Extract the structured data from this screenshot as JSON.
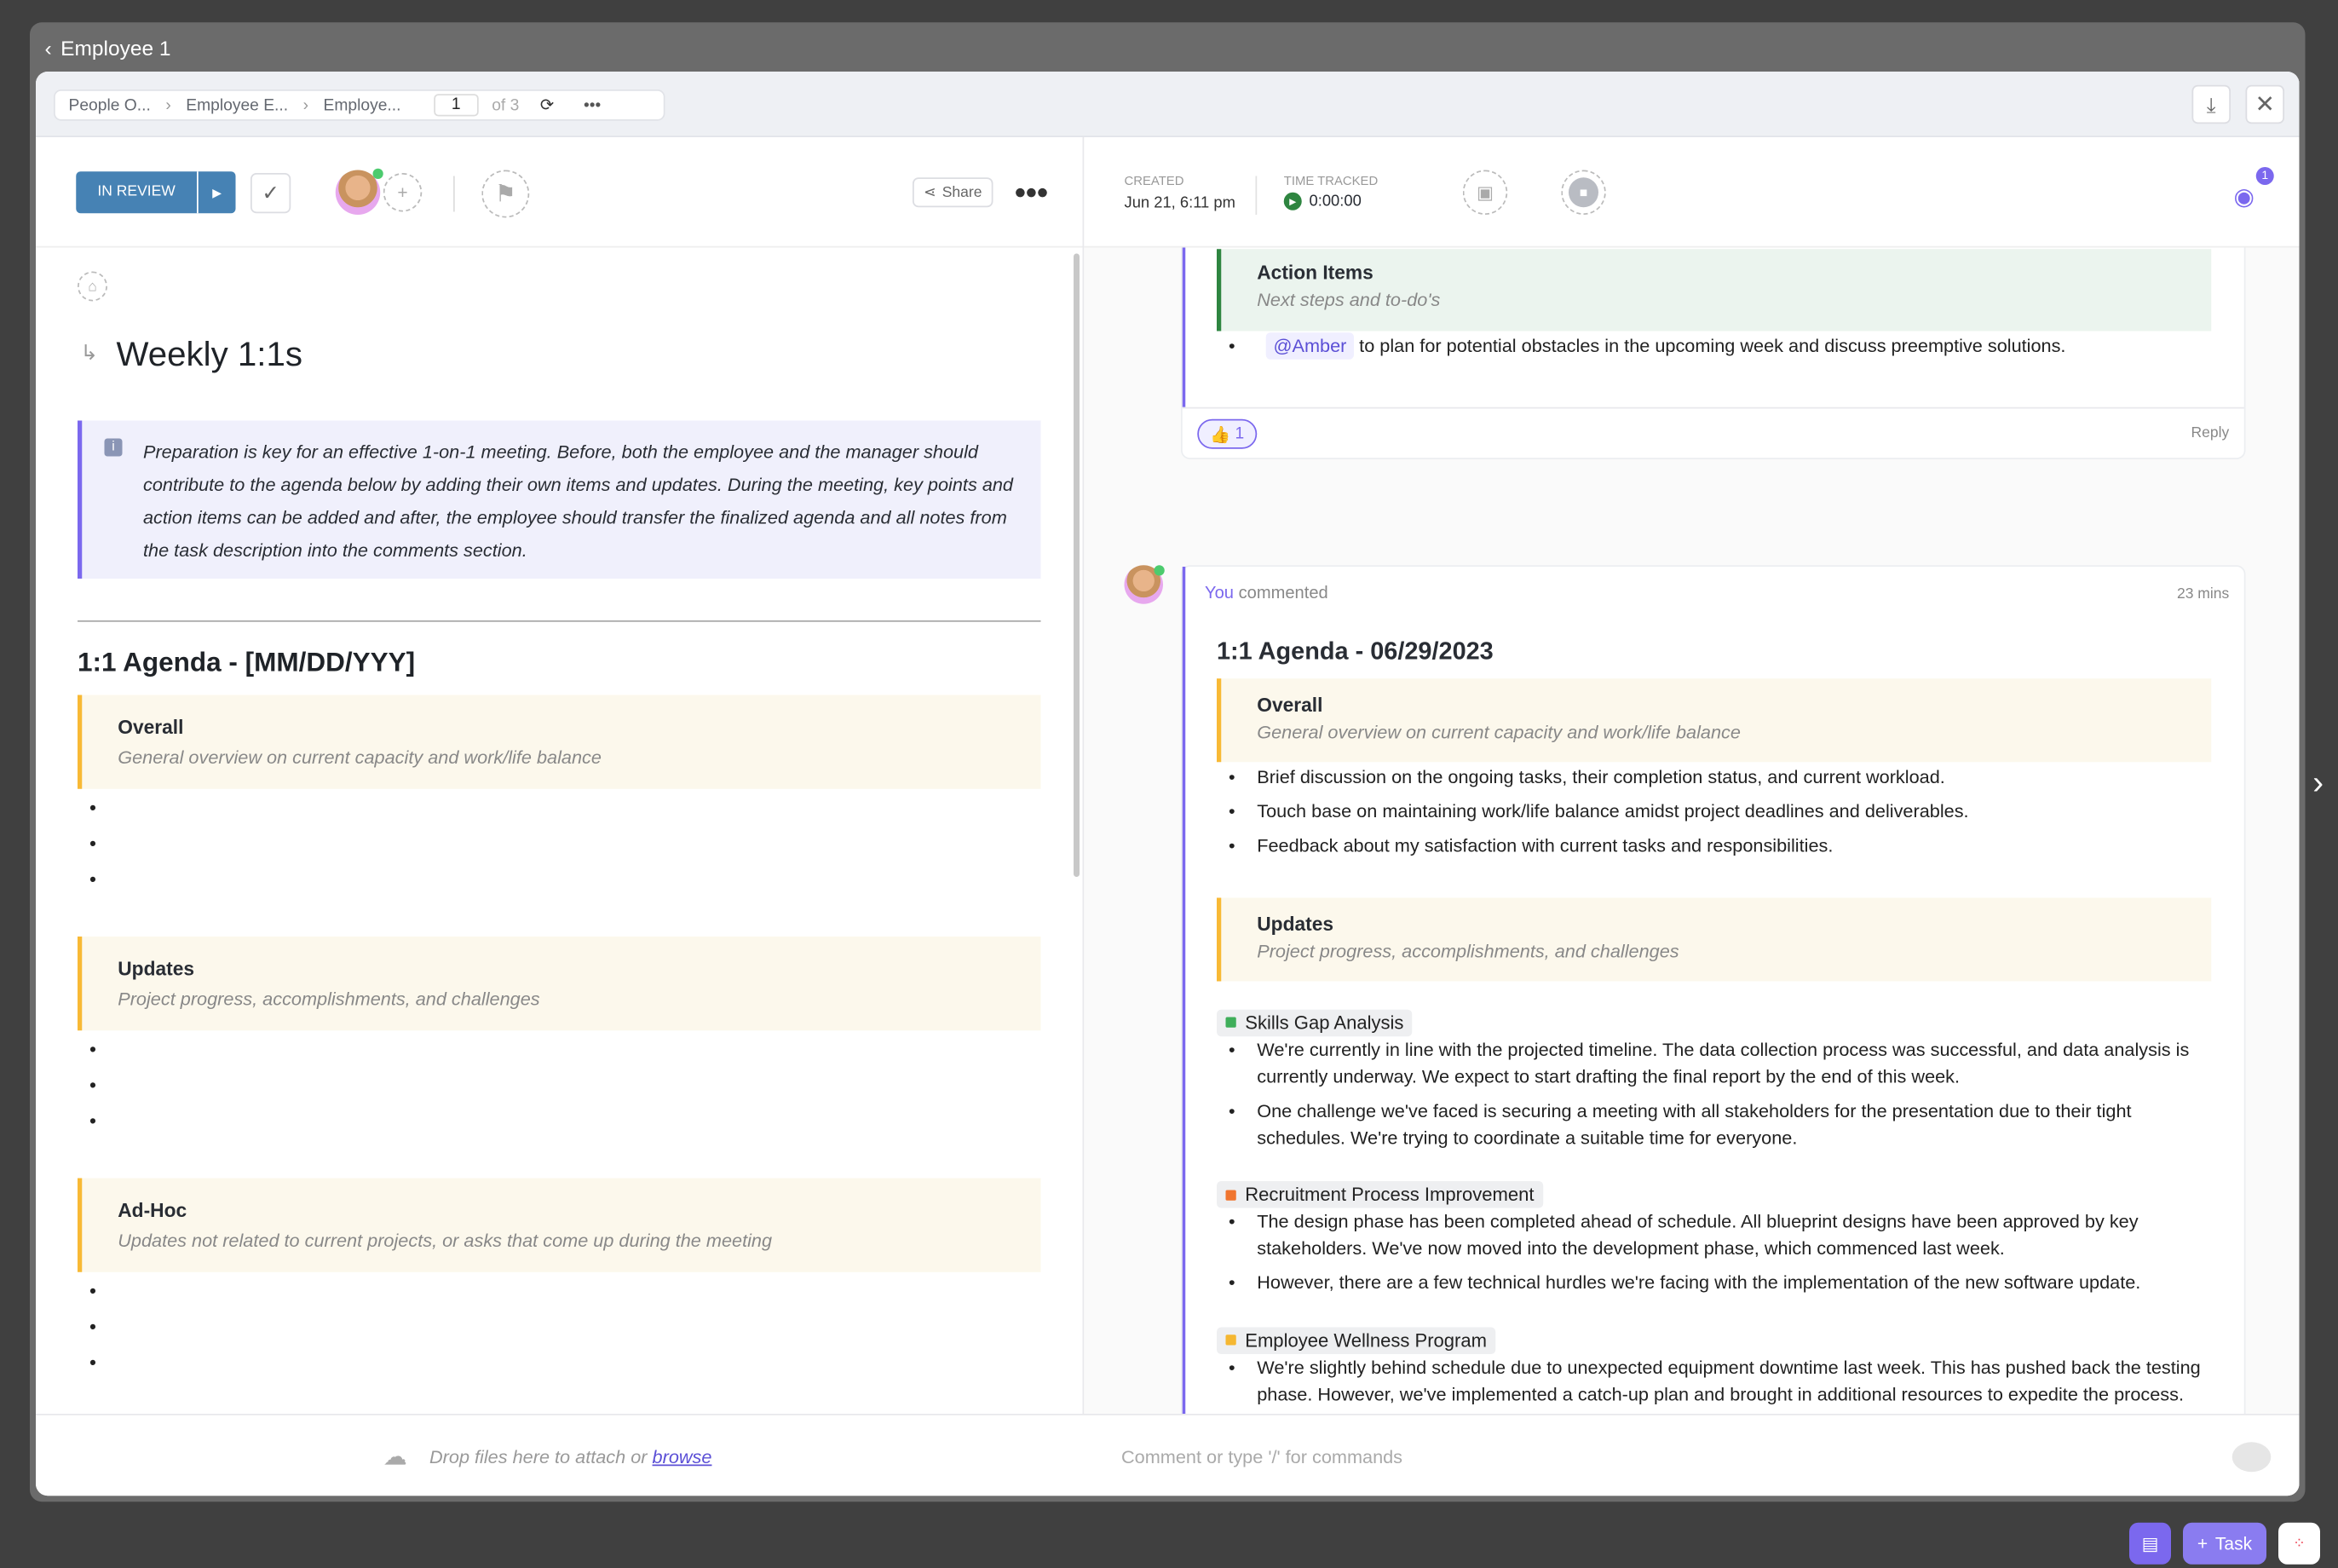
{
  "window": {
    "title": "Employee 1"
  },
  "breadcrumb": {
    "items": [
      "People O...",
      "Employee E...",
      "Employe..."
    ],
    "page": "1",
    "of": "of 3"
  },
  "toolbar": {
    "status": "IN REVIEW",
    "share": "Share"
  },
  "meta": {
    "created_label": "CREATED",
    "created_value": "Jun 21, 6:11 pm",
    "time_label": "TIME TRACKED",
    "time_value": "0:00:00",
    "watchers": "1"
  },
  "task": {
    "title": "Weekly 1:1s",
    "info": "Preparation is key for an effective 1-on-1 meeting. Before, both the employee and the manager should contribute to the agenda below by adding their own items and updates. During the meeting, key points and action items can be added and after, the employee should transfer the finalized agenda and all notes from the task description into the comments section.",
    "agenda": "1:1 Agenda - [MM/DD/YYY]",
    "sections": [
      {
        "title": "Overall",
        "sub": "General overview on current capacity and work/life balance"
      },
      {
        "title": "Updates",
        "sub": "Project progress, accomplishments, and challenges"
      },
      {
        "title": "Ad-Hoc",
        "sub": "Updates not related to current projects, or asks that come up during the meeting"
      }
    ]
  },
  "comments": {
    "prev": {
      "title": "Action Items",
      "sub": "Next steps and to-do's",
      "mention": "@Amber",
      "text": "to plan for potential obstacles in the upcoming week and discuss preemptive solutions.",
      "reaction": "1",
      "reply": "Reply"
    },
    "current": {
      "author": "You",
      "action": "commented",
      "time": "23 mins",
      "heading": "1:1 Agenda - 06/29/2023",
      "overall": {
        "title": "Overall",
        "sub": "General overview on current capacity and work/life balance",
        "items": [
          " Brief discussion on the ongoing tasks, their completion status, and current workload.",
          "Touch base on maintaining work/life balance amidst project deadlines and deliverables.",
          "Feedback about my satisfaction with current tasks and responsibilities."
        ]
      },
      "updates": {
        "title": "Updates",
        "sub": "Project progress, accomplishments, and challenges"
      },
      "projects": [
        {
          "name": "Skills Gap Analysis",
          "color": "#3fae5a",
          "items": [
            "We're currently in line with the projected timeline. The data collection process was successful, and data analysis is currently underway. We expect to start drafting the final report by the end of this week.",
            "One challenge we've faced is securing a meeting with all stakeholders for the presentation due to their tight schedules. We're trying to coordinate a suitable time for everyone."
          ]
        },
        {
          "name": "Recruitment Process Improvement",
          "color": "#f0752f",
          "items": [
            "The design phase has been completed ahead of schedule. All blueprint designs have been approved by key stakeholders. We've now moved into the development phase, which commenced last week.",
            "However, there are a few technical hurdles we're facing with the implementation of the new software update."
          ]
        },
        {
          "name": "Employee Wellness Program",
          "color": "#f5b731",
          "items": [
            "We're slightly behind schedule due to unexpected equipment downtime last week. This has pushed back the testing phase. However, we've implemented a catch-up plan and brought in additional resources to expedite the process."
          ]
        }
      ]
    }
  },
  "footer": {
    "drop": "Drop files here to attach or ",
    "browse": "browse",
    "comment_placeholder": "Comment or type '/' for commands"
  },
  "dock": {
    "task": "Task"
  },
  "colors": {
    "accent": "#7b68ee",
    "status": "#4682b4"
  }
}
